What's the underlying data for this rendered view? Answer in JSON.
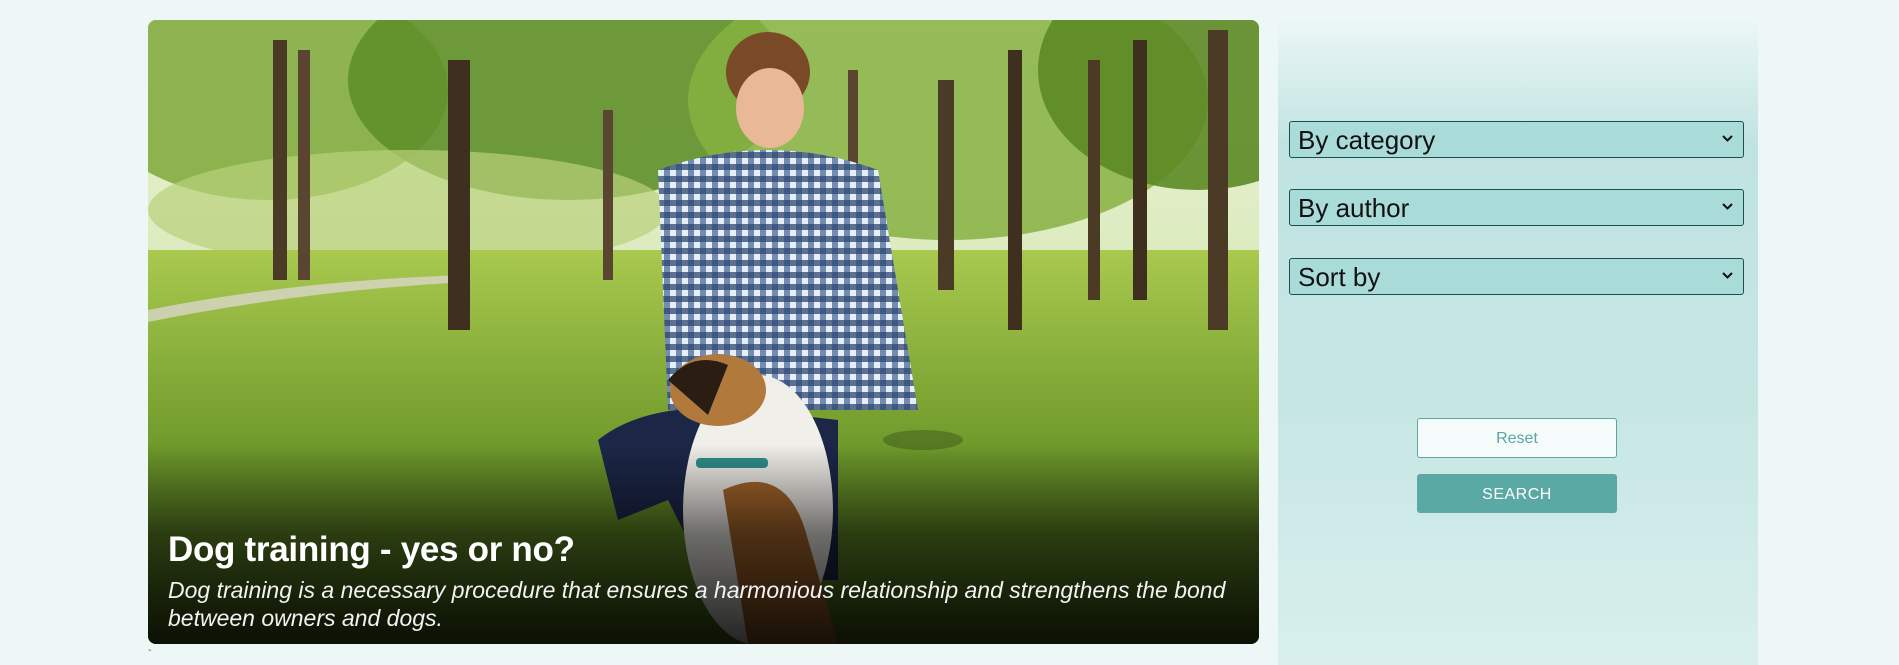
{
  "hero": {
    "title": "Dog training - yes or no?",
    "description": "Dog training is a necessary procedure that ensures a harmonious relationship and strengthens the bond between owners and dogs."
  },
  "stray_mark": "-",
  "filters": {
    "category": {
      "selected": "By category"
    },
    "author": {
      "selected": "By author"
    },
    "sort": {
      "selected": "Sort by"
    }
  },
  "actions": {
    "reset_label": "Reset",
    "search_label": "SEARCH"
  },
  "colors": {
    "page_bg": "#edf7f6",
    "sidebar_mid": "#bfe3e1",
    "select_bg": "#a5dad7",
    "accent": "#5ba9a5"
  },
  "icons": {
    "dropdown": "chevron-down-icon"
  }
}
